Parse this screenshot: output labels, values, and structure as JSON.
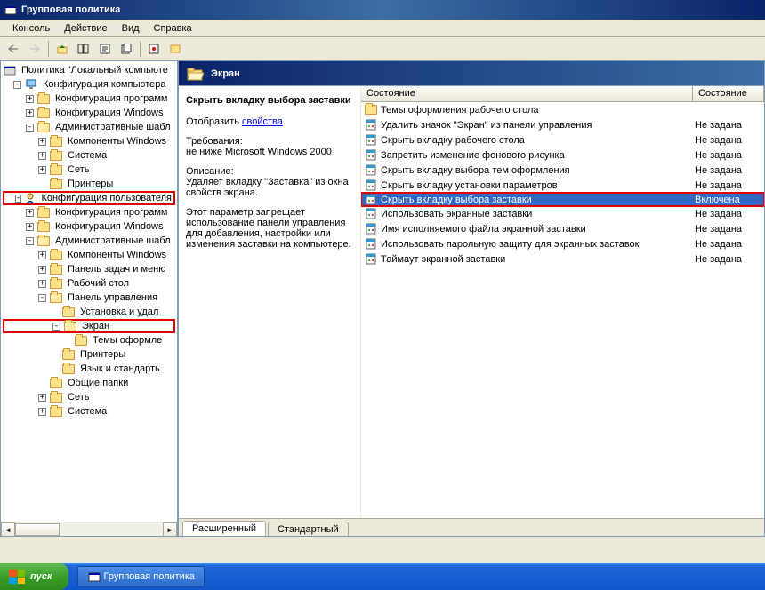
{
  "window": {
    "title": "Групповая политика"
  },
  "menu": {
    "console": "Консоль",
    "action": "Действие",
    "view": "Вид",
    "help": "Справка"
  },
  "tree": {
    "root": "Политика \"Локальный компьюте",
    "comp_config": "Конфигурация компьютера",
    "comp_prog": "Конфигурация программ",
    "comp_win": "Конфигурация Windows",
    "comp_admin": "Административные шабл",
    "comp_win_comp": "Компоненты Windows",
    "comp_system": "Система",
    "comp_network": "Сеть",
    "comp_printers": "Принтеры",
    "user_config": "Конфигурация пользователя",
    "user_prog": "Конфигурация программ",
    "user_win": "Конфигурация Windows",
    "user_admin": "Административные шабл",
    "user_comp": "Компоненты Windows",
    "user_taskbar": "Панель задач и меню",
    "user_desktop": "Рабочий стол",
    "user_cpanel": "Панель управления",
    "user_install": "Установка и удал",
    "user_screen": "Экран",
    "user_themes": "Темы оформле",
    "user_printers": "Принтеры",
    "user_lang": "Язык и стандарть",
    "user_shared": "Общие папки",
    "user_network": "Сеть",
    "user_system": "Система"
  },
  "header": {
    "title": "Экран"
  },
  "desc": {
    "title": "Скрыть вкладку выбора заставки",
    "show": "Отобразить",
    "show_link": "свойства",
    "req_label": "Требования:",
    "req_text": "не ниже Microsoft Windows 2000",
    "desc_label": "Описание:",
    "desc_text": "Удаляет вкладку \"Заставка\" из окна свойств экрана.",
    "desc_text2": "Этот параметр запрещает использование панели управления для добавления, настройки или изменения заставки на компьютере."
  },
  "cols": {
    "name": "Состояние",
    "state": "Состояние"
  },
  "state_none": "Не задана",
  "state_on": "Включена",
  "settings": [
    {
      "name": "Темы оформления рабочего стола",
      "state": "",
      "type": "folder"
    },
    {
      "name": "Удалить значок \"Экран\" из панели управления",
      "state": "Не задана",
      "type": "item"
    },
    {
      "name": "Скрыть вкладку рабочего стола",
      "state": "Не задана",
      "type": "item"
    },
    {
      "name": "Запретить изменение фонового рисунка",
      "state": "Не задана",
      "type": "item"
    },
    {
      "name": "Скрыть вкладку выбора тем оформления",
      "state": "Не задана",
      "type": "item"
    },
    {
      "name": "Скрыть вкладку установки параметров",
      "state": "Не задана",
      "type": "item"
    },
    {
      "name": "Скрыть вкладку выбора заставки",
      "state": "Включена",
      "type": "item",
      "selected": true
    },
    {
      "name": "Использовать экранные заставки",
      "state": "Не задана",
      "type": "item"
    },
    {
      "name": "Имя исполняемого файла экранной заставки",
      "state": "Не задана",
      "type": "item"
    },
    {
      "name": "Использовать парольную защиту для экранных заставок",
      "state": "Не задана",
      "type": "item"
    },
    {
      "name": "Таймаут экранной заставки",
      "state": "Не задана",
      "type": "item"
    }
  ],
  "tabs": {
    "extended": "Расширенный",
    "standard": "Стандартный"
  },
  "taskbar": {
    "start": "пуск",
    "task1": "Групповая политика"
  }
}
